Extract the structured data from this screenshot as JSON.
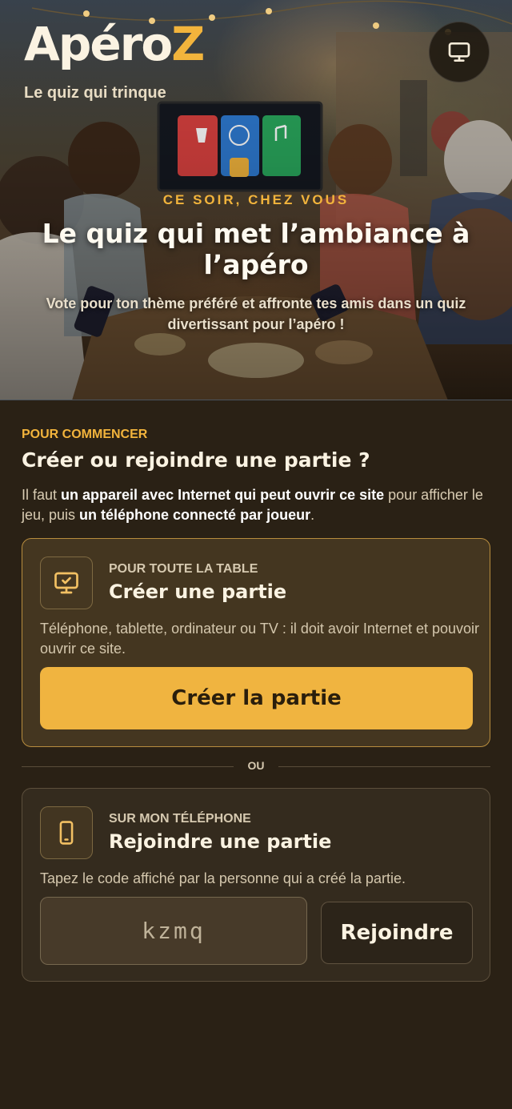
{
  "brand": {
    "logo_main": "Apéro",
    "logo_accent": "Z",
    "tagline": "Le quiz qui trinque"
  },
  "header": {
    "screen_icon": "monitor-icon"
  },
  "hero": {
    "kicker": "CE SOIR, CHEZ VOUS",
    "title": "Le quiz qui met l’ambiance à l’apéro",
    "subtitle": "Vote pour ton thème préféré et affronte tes amis dans un quiz divertissant pour l’apéro !"
  },
  "start": {
    "eyebrow": "POUR COMMENCER",
    "title": "Créer ou rejoindre une partie ?",
    "intro": {
      "p1": "Il faut ",
      "b1": "un appareil avec Internet qui peut ouvrir ce site",
      "p2": " pour afficher le jeu, puis ",
      "b2": "un téléphone connecté par joueur",
      "p3": "."
    }
  },
  "create_card": {
    "icon": "monitor-check-icon",
    "eyebrow": "POUR TOUTE LA TABLE",
    "title": "Créer une partie",
    "description": "Téléphone, tablette, ordinateur ou TV : il doit avoir Internet et pouvoir ouvrir ce site.",
    "button_label": "Créer la partie"
  },
  "divider_label": "OU",
  "join_card": {
    "icon": "smartphone-icon",
    "eyebrow": "SUR MON TÉLÉPHONE",
    "title": "Rejoindre une partie",
    "description": "Tapez le code affiché par la personne qui a créé la partie.",
    "code_placeholder": "kzmq",
    "button_label": "Rejoindre"
  },
  "colors": {
    "accent": "#f0b440",
    "background": "#2a2115",
    "card_border_active": "#b88d3e"
  }
}
